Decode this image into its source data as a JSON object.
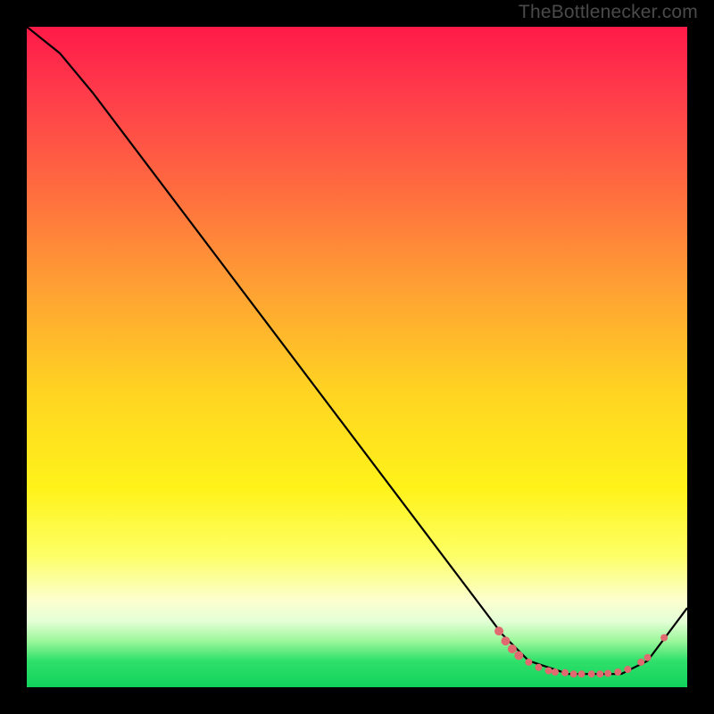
{
  "watermark": "TheBottlenecker.com",
  "chart_data": {
    "type": "line",
    "title": "",
    "xlabel": "",
    "ylabel": "",
    "xlim": [
      0,
      1
    ],
    "ylim": [
      0,
      1
    ],
    "series": [
      {
        "name": "curve",
        "x": [
          0.0,
          0.05,
          0.1,
          0.72,
          0.76,
          0.82,
          0.9,
          0.94,
          1.0
        ],
        "y": [
          1.0,
          0.96,
          0.9,
          0.08,
          0.04,
          0.02,
          0.02,
          0.04,
          0.12
        ]
      }
    ],
    "markers": [
      {
        "x": 0.715,
        "y": 0.085,
        "r": 5
      },
      {
        "x": 0.725,
        "y": 0.07,
        "r": 5
      },
      {
        "x": 0.735,
        "y": 0.058,
        "r": 5
      },
      {
        "x": 0.745,
        "y": 0.048,
        "r": 5
      },
      {
        "x": 0.76,
        "y": 0.038,
        "r": 4
      },
      {
        "x": 0.775,
        "y": 0.03,
        "r": 4
      },
      {
        "x": 0.79,
        "y": 0.025,
        "r": 4
      },
      {
        "x": 0.8,
        "y": 0.023,
        "r": 4
      },
      {
        "x": 0.815,
        "y": 0.022,
        "r": 4
      },
      {
        "x": 0.828,
        "y": 0.02,
        "r": 4
      },
      {
        "x": 0.84,
        "y": 0.02,
        "r": 4
      },
      {
        "x": 0.855,
        "y": 0.02,
        "r": 4
      },
      {
        "x": 0.868,
        "y": 0.02,
        "r": 4
      },
      {
        "x": 0.88,
        "y": 0.021,
        "r": 4
      },
      {
        "x": 0.895,
        "y": 0.023,
        "r": 4
      },
      {
        "x": 0.91,
        "y": 0.027,
        "r": 4
      },
      {
        "x": 0.93,
        "y": 0.038,
        "r": 4
      },
      {
        "x": 0.94,
        "y": 0.045,
        "r": 4
      },
      {
        "x": 0.965,
        "y": 0.075,
        "r": 4
      }
    ],
    "marker_color": "#e06a6f",
    "curve_color": "#000000"
  }
}
